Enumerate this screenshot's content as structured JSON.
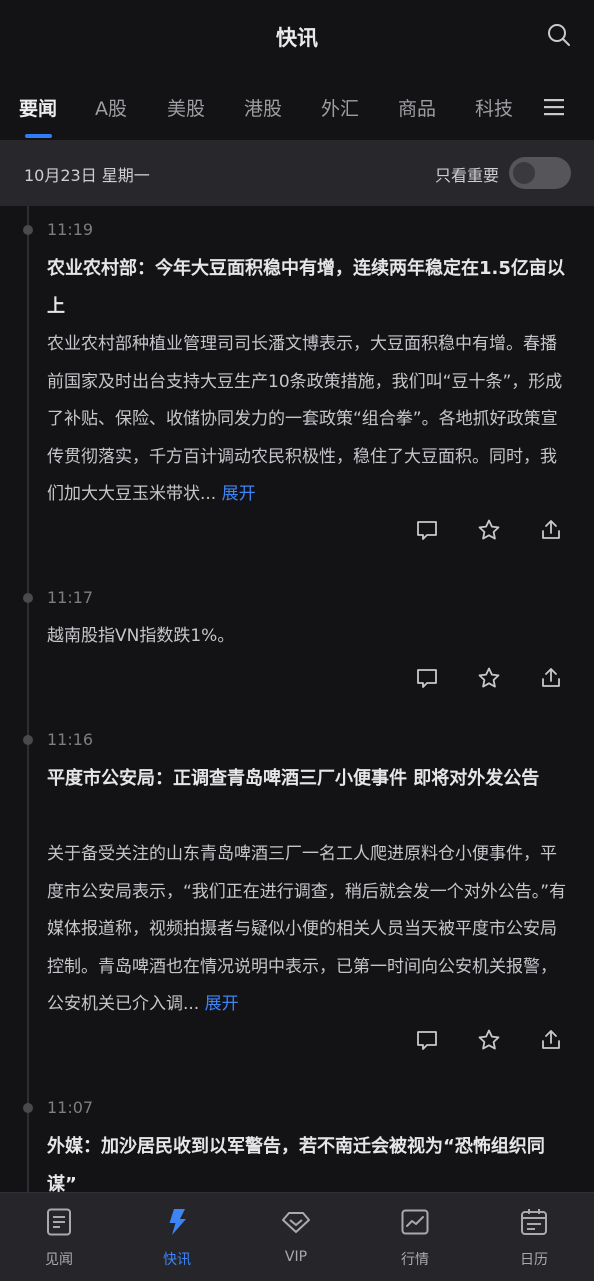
{
  "header": {
    "title": "快讯"
  },
  "tabs": [
    "要闻",
    "A股",
    "美股",
    "港股",
    "外汇",
    "商品",
    "科技"
  ],
  "date_bar": {
    "date": "10月23日 星期一",
    "important_label": "只看重要",
    "important_only": false
  },
  "news": [
    {
      "time": "11:19",
      "headline": "农业农村部：今年大豆面积稳中有增，连续两年稳定在1.5亿亩以上",
      "body": "农业农村部种植业管理司司长潘文博表示，大豆面积稳中有增。春播前国家及时出台支持大豆生产10条政策措施，我们叫“豆十条”，形成了补贴、保险、收储协同发力的一套政策“组合拳”。各地抓好政策宣传贯彻落实，千方百计调动农民积极性，稳住了大豆面积。同时，我们加大大豆玉米带状...",
      "expand_label": "展开"
    },
    {
      "time": "11:17",
      "headline": "",
      "body": "越南股指VN指数跌1%。",
      "expand_label": ""
    },
    {
      "time": "11:16",
      "headline": "平度市公安局：正调查青岛啤酒三厂小便事件 即将对外发公告",
      "body": "关于备受关注的山东青岛啤酒三厂一名工人爬进原料仓小便事件，平度市公安局表示，“我们正在进行调查，稍后就会发一个对外公告。”有媒体报道称，视频拍摄者与疑似小便的相关人员当天被平度市公安局控制。青岛啤酒也在情况说明中表示，已第一时间向公安机关报警，公安机关已介入调...",
      "expand_label": "展开"
    },
    {
      "time": "11:07",
      "headline": "外媒：加沙居民收到以军警告，若不南迁会被视为“恐怖组织同谋”",
      "body": "",
      "expand_label": ""
    }
  ],
  "bottom_nav": [
    {
      "label": "见闻",
      "icon": "document-icon",
      "active": false
    },
    {
      "label": "快讯",
      "icon": "lightning-icon",
      "active": true
    },
    {
      "label": "VIP",
      "icon": "diamond-icon",
      "active": false
    },
    {
      "label": "行情",
      "icon": "chart-icon",
      "active": false
    },
    {
      "label": "日历",
      "icon": "calendar-icon",
      "active": false
    }
  ],
  "colors": {
    "accent": "#2f7cf6",
    "background": "#131315",
    "date_bar": "#28282c",
    "tab_bar": "#26262a"
  }
}
